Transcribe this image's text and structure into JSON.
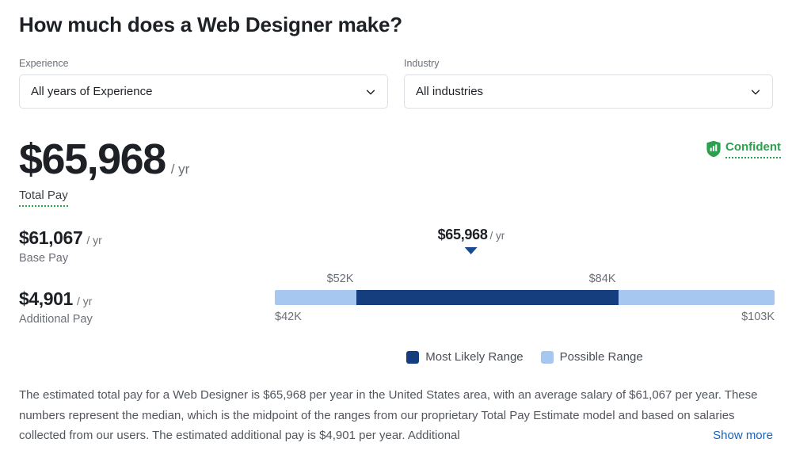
{
  "header": {
    "title": "How much does a Web Designer make?"
  },
  "filters": [
    {
      "label": "Experience",
      "value": "All years of Experience",
      "icon": "chevron-down-icon"
    },
    {
      "label": "Industry",
      "value": "All industries",
      "icon": "chevron-down-icon"
    }
  ],
  "confidence_badge": {
    "label": "Confident",
    "icon": "shield-bar-chart-icon",
    "color": "#2ba14d"
  },
  "total_pay": {
    "amount": "$65,968",
    "unit": "/ yr",
    "label": "Total Pay"
  },
  "pay_breakdown": [
    {
      "amount": "$61,067",
      "unit": "/ yr",
      "label": "Base Pay"
    },
    {
      "amount": "$4,901",
      "unit": "/ yr",
      "label": "Additional Pay"
    }
  ],
  "chart_data": {
    "type": "bar",
    "title": "",
    "xlabel": "",
    "ylabel": "",
    "orientation": "horizontal",
    "grid": false,
    "legend_position": "bottom-center",
    "xlim": [
      42000,
      103000
    ],
    "range_min_label": "$42K",
    "range_max_label": "$103K",
    "range_min_value": 42000,
    "range_max_value": 103000,
    "likely_min_label": "$52K",
    "likely_max_label": "$84K",
    "likely_min_value": 52000,
    "likely_max_value": 84000,
    "median_label": "$65,968",
    "median_unit": "/ yr",
    "median_value": 65968,
    "colors": {
      "most_likely_range": "#153e7e",
      "possible_range": "#a6c8f0",
      "marker": "#184a90"
    },
    "legend": [
      {
        "label": "Most Likely Range",
        "color": "#153e7e"
      },
      {
        "label": "Possible Range",
        "color": "#a6c8f0"
      }
    ]
  },
  "description": {
    "text": "The estimated total pay for a Web Designer is $65,968 per year in the United States area, with an average salary of $61,067 per year. These numbers represent the median, which is the midpoint of the ranges from our proprietary Total Pay Estimate model and based on salaries collected from our users. The estimated additional pay is $4,901 per year. Additional",
    "show_more_label": "Show more"
  }
}
